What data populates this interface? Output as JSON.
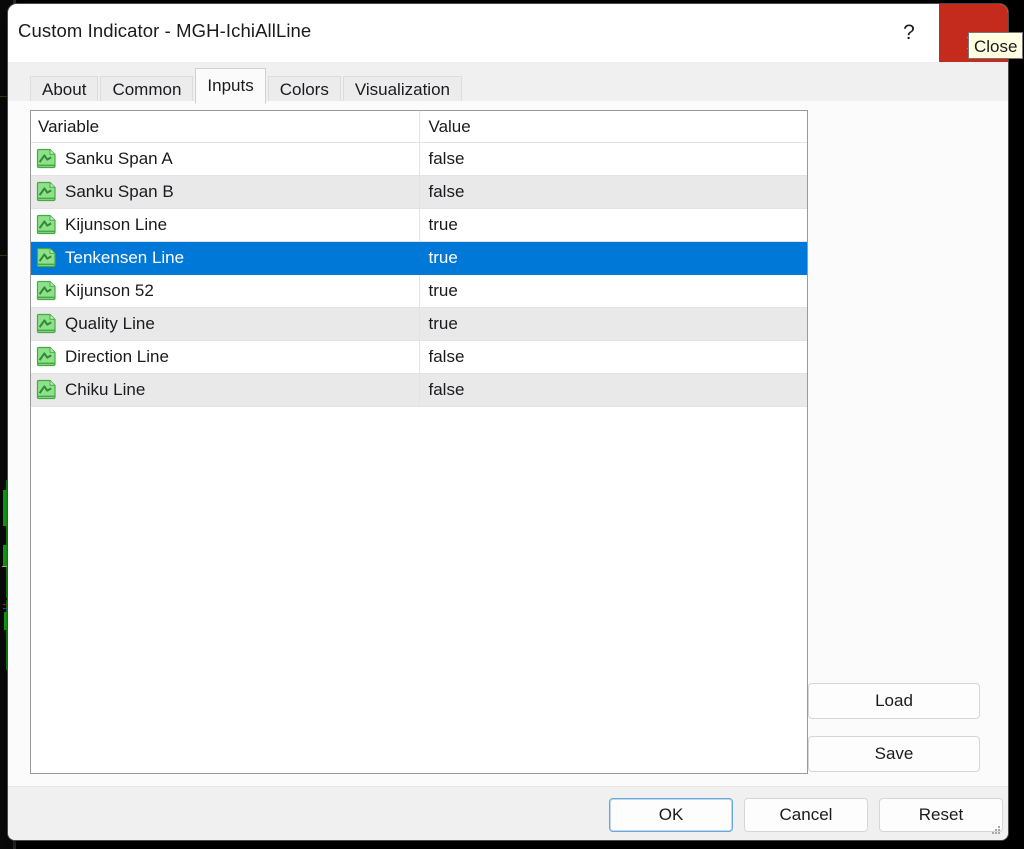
{
  "window": {
    "title": "Custom Indicator - MGH-IchiAllLine",
    "help_label": "?",
    "close_icon": "close-icon",
    "close_tooltip": "Close",
    "close_button_color": "#c42b1c",
    "selection_color": "#0078d7",
    "accent_focus_color": "#6aa6dc"
  },
  "tabs": [
    {
      "label": "About",
      "active": false
    },
    {
      "label": "Common",
      "active": false
    },
    {
      "label": "Inputs",
      "active": true
    },
    {
      "label": "Colors",
      "active": false
    },
    {
      "label": "Visualization",
      "active": false
    }
  ],
  "inputs_table": {
    "columns": [
      "Variable",
      "Value"
    ],
    "rows": [
      {
        "icon": "indicator-input-icon",
        "variable": "Sanku Span A",
        "value": "false",
        "selected": false
      },
      {
        "icon": "indicator-input-icon",
        "variable": "Sanku Span B",
        "value": "false",
        "selected": false
      },
      {
        "icon": "indicator-input-icon",
        "variable": "Kijunson Line",
        "value": "true",
        "selected": false
      },
      {
        "icon": "indicator-input-icon",
        "variable": "Tenkensen Line",
        "value": "true",
        "selected": true
      },
      {
        "icon": "indicator-input-icon",
        "variable": "Kijunson 52",
        "value": "true",
        "selected": false
      },
      {
        "icon": "indicator-input-icon",
        "variable": "Quality Line",
        "value": "true",
        "selected": false
      },
      {
        "icon": "indicator-input-icon",
        "variable": "Direction Line",
        "value": "false",
        "selected": false
      },
      {
        "icon": "indicator-input-icon",
        "variable": "Chiku Line",
        "value": "false",
        "selected": false
      }
    ]
  },
  "side_buttons": {
    "load_label": "Load",
    "save_label": "Save"
  },
  "footer_buttons": {
    "ok_label": "OK",
    "cancel_label": "Cancel",
    "reset_label": "Reset"
  }
}
